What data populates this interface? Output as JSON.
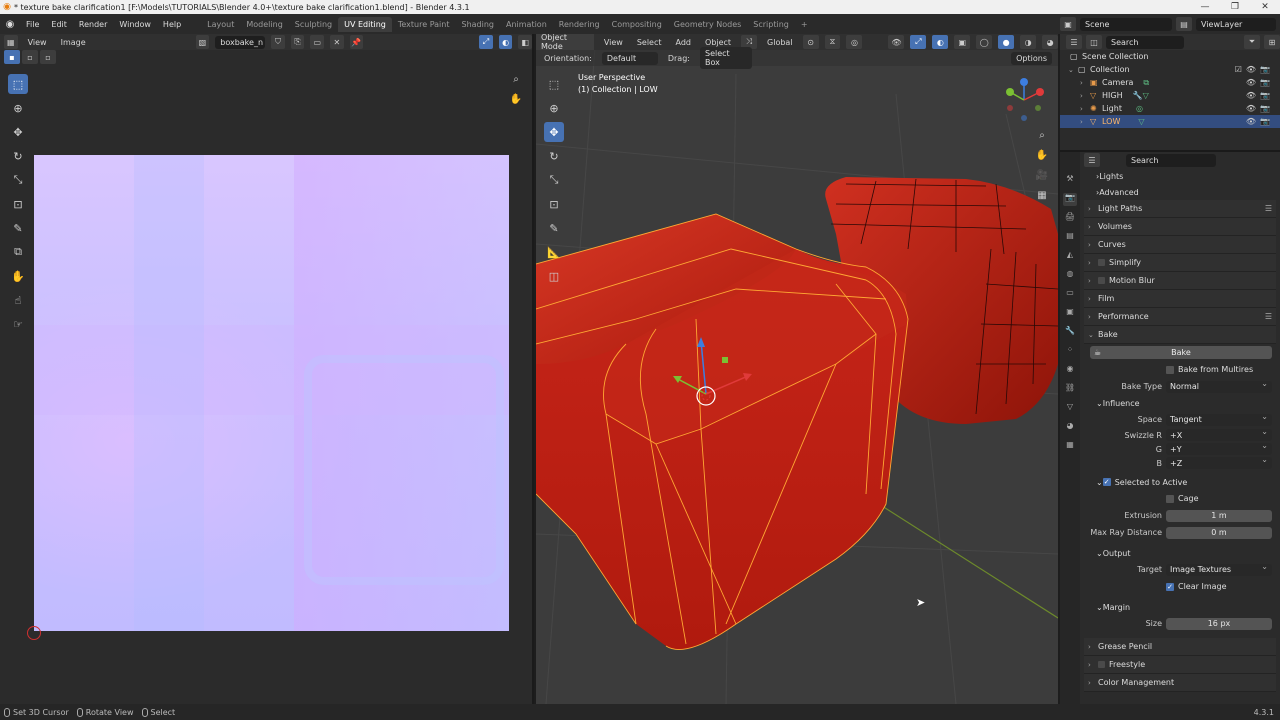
{
  "titlebar": {
    "title": "* texture bake clarification1 [F:\\Models\\TUTORIALS\\Blender 4.0+\\texture bake clarification1.blend] - Blender 4.3.1",
    "minimize": "—",
    "maximize": "❐",
    "close": "✕"
  },
  "menu": {
    "items": [
      "File",
      "Edit",
      "Render",
      "Window",
      "Help"
    ],
    "workspaces": [
      "Layout",
      "Modeling",
      "Sculpting",
      "UV Editing",
      "Texture Paint",
      "Shading",
      "Animation",
      "Rendering",
      "Compositing",
      "Geometry Nodes",
      "Scripting"
    ],
    "active_workspace": "UV Editing",
    "add": "+",
    "scene": "Scene",
    "view_layer": "ViewLayer"
  },
  "uv_editor": {
    "view": "View",
    "image": "Image",
    "image_name": "boxbake_n"
  },
  "viewport": {
    "mode": "Object Mode",
    "menus": [
      "View",
      "Select",
      "Add",
      "Object"
    ],
    "transform": "Global",
    "orientation_label": "Orientation:",
    "orientation_value": "Default",
    "drag_label": "Drag:",
    "drag_value": "Select Box",
    "options": "Options",
    "perspective": "User Perspective",
    "collection_info": "(1) Collection | LOW"
  },
  "outliner": {
    "search_placeholder": "Search",
    "scene_collection": "Scene Collection",
    "collection": "Collection",
    "objects": [
      "Camera",
      "HIGH",
      "Light",
      "LOW"
    ]
  },
  "properties": {
    "search_placeholder": "Search",
    "lights": "Lights",
    "advanced": "Advanced",
    "light_paths": "Light Paths",
    "volumes": "Volumes",
    "curves": "Curves",
    "simplify": "Simplify",
    "motion_blur": "Motion Blur",
    "film": "Film",
    "performance": "Performance",
    "bake": "Bake",
    "bake_button": "Bake",
    "bake_from_multires": "Bake from Multires",
    "bake_type_label": "Bake Type",
    "bake_type_value": "Normal",
    "influence": "Influence",
    "space_label": "Space",
    "space_value": "Tangent",
    "swizzle_r_label": "Swizzle R",
    "swizzle_r_value": "+X",
    "g_label": "G",
    "g_value": "+Y",
    "b_label": "B",
    "b_value": "+Z",
    "selected_to_active": "Selected to Active",
    "cage": "Cage",
    "extrusion_label": "Extrusion",
    "extrusion_value": "1 m",
    "max_ray_label": "Max Ray Distance",
    "max_ray_value": "0 m",
    "output": "Output",
    "target_label": "Target",
    "target_value": "Image Textures",
    "clear_image": "Clear Image",
    "margin": "Margin",
    "size_label": "Size",
    "size_value": "16 px",
    "grease_pencil": "Grease Pencil",
    "freestyle": "Freestyle",
    "color_management": "Color Management"
  },
  "statusbar": {
    "set_cursor": "Set 3D Cursor",
    "rotate_view": "Rotate View",
    "select": "Select",
    "version": "4.3.1"
  },
  "colors": {
    "accent": "#4772b3",
    "selection_outline": "#ffa733",
    "mesh_red": "#c4200e"
  }
}
